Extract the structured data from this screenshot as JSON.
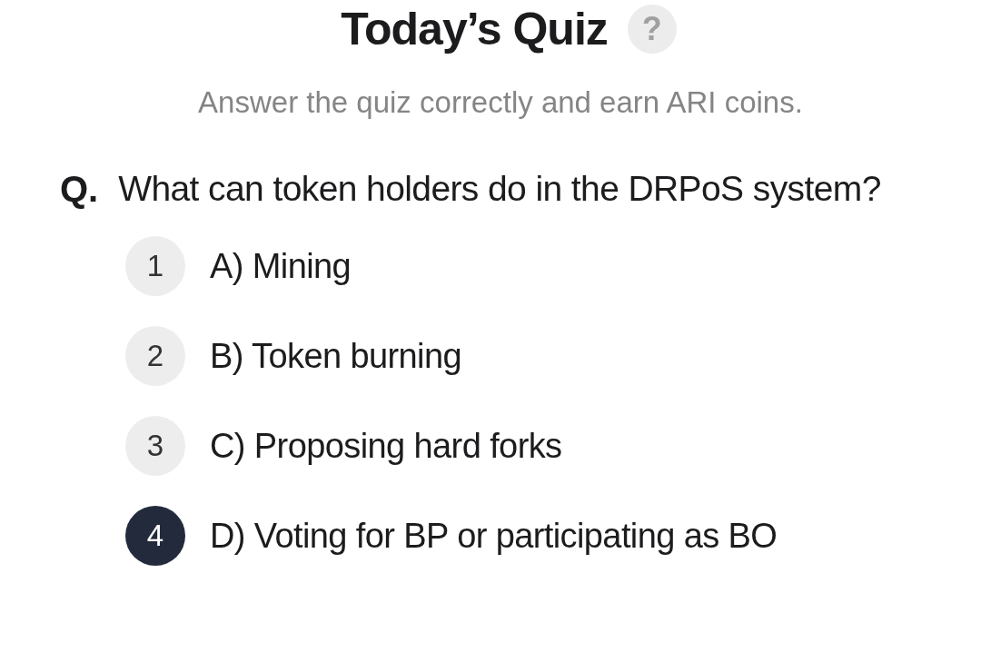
{
  "header": {
    "title": "Today’s Quiz",
    "help": "?"
  },
  "subtitle": "Answer the quiz correctly and earn ARI coins.",
  "question": {
    "prefix": "Q.",
    "text": "What can token holders do in the DRPoS system?"
  },
  "options": [
    {
      "number": "1",
      "label": "A) Mining",
      "selected": false
    },
    {
      "number": "2",
      "label": "B) Token burning",
      "selected": false
    },
    {
      "number": "3",
      "label": "C) Proposing hard forks",
      "selected": false
    },
    {
      "number": "4",
      "label": "D) Voting for BP or participating as BO",
      "selected": true
    }
  ]
}
